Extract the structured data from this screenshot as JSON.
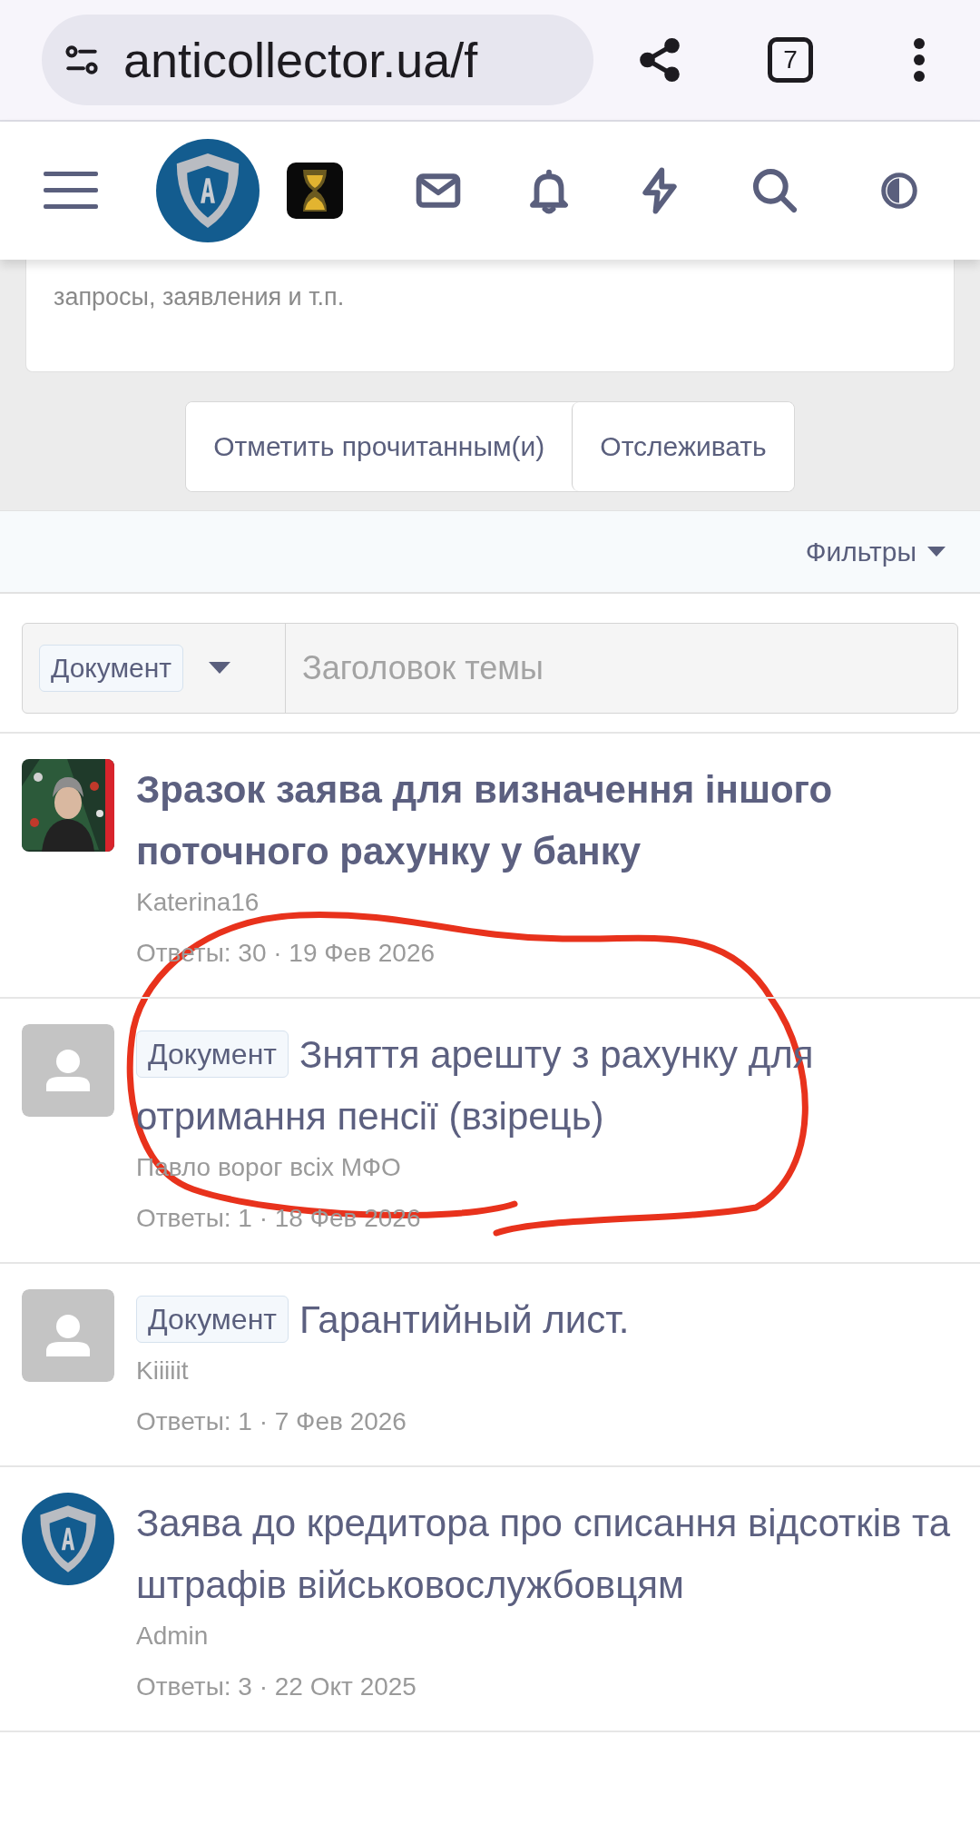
{
  "browser": {
    "url": "anticollector.ua/f",
    "tab_count": "7"
  },
  "forum_description": "запросы, заявления и т.п.",
  "actions": [
    "Отметить прочитанным(и)",
    "Отслеживать"
  ],
  "filters": {
    "label": "Фильтры"
  },
  "search": {
    "prefix_tag": "Документ",
    "placeholder": "Заголовок темы"
  },
  "threads": [
    {
      "title": "Зразок заява для визначення іншого поточного рахунку у банку",
      "unread": true,
      "author": "Katerina16",
      "meta": "Ответы: 30 · 19 Фев 2026"
    },
    {
      "avatar": {
        "kind": "placeholder"
      },
      "tag": "Документ",
      "title": "Зняття арешту з рахунку для отримання пенсії (взірець)",
      "unread": false,
      "author": "Павло ворог всіх МФО",
      "meta": "Ответы: 1 · 18 Фев 2026"
    },
    {
      "avatar": {
        "kind": "placeholder"
      },
      "tag": "Документ",
      "title": "Гарантийный лист.",
      "unread": false,
      "author": "Kiiiiit",
      "meta": "Ответы: 1 · 7 Фев 2026"
    },
    {
      "avatar": {
        "kind": "logo"
      },
      "title": "Заява до кредитора про списання відсотків та штрафів військовослужбовцям",
      "unread": false,
      "author": "Admin",
      "meta": "Ответы: 3 · 22 Окт 2025"
    }
  ]
}
